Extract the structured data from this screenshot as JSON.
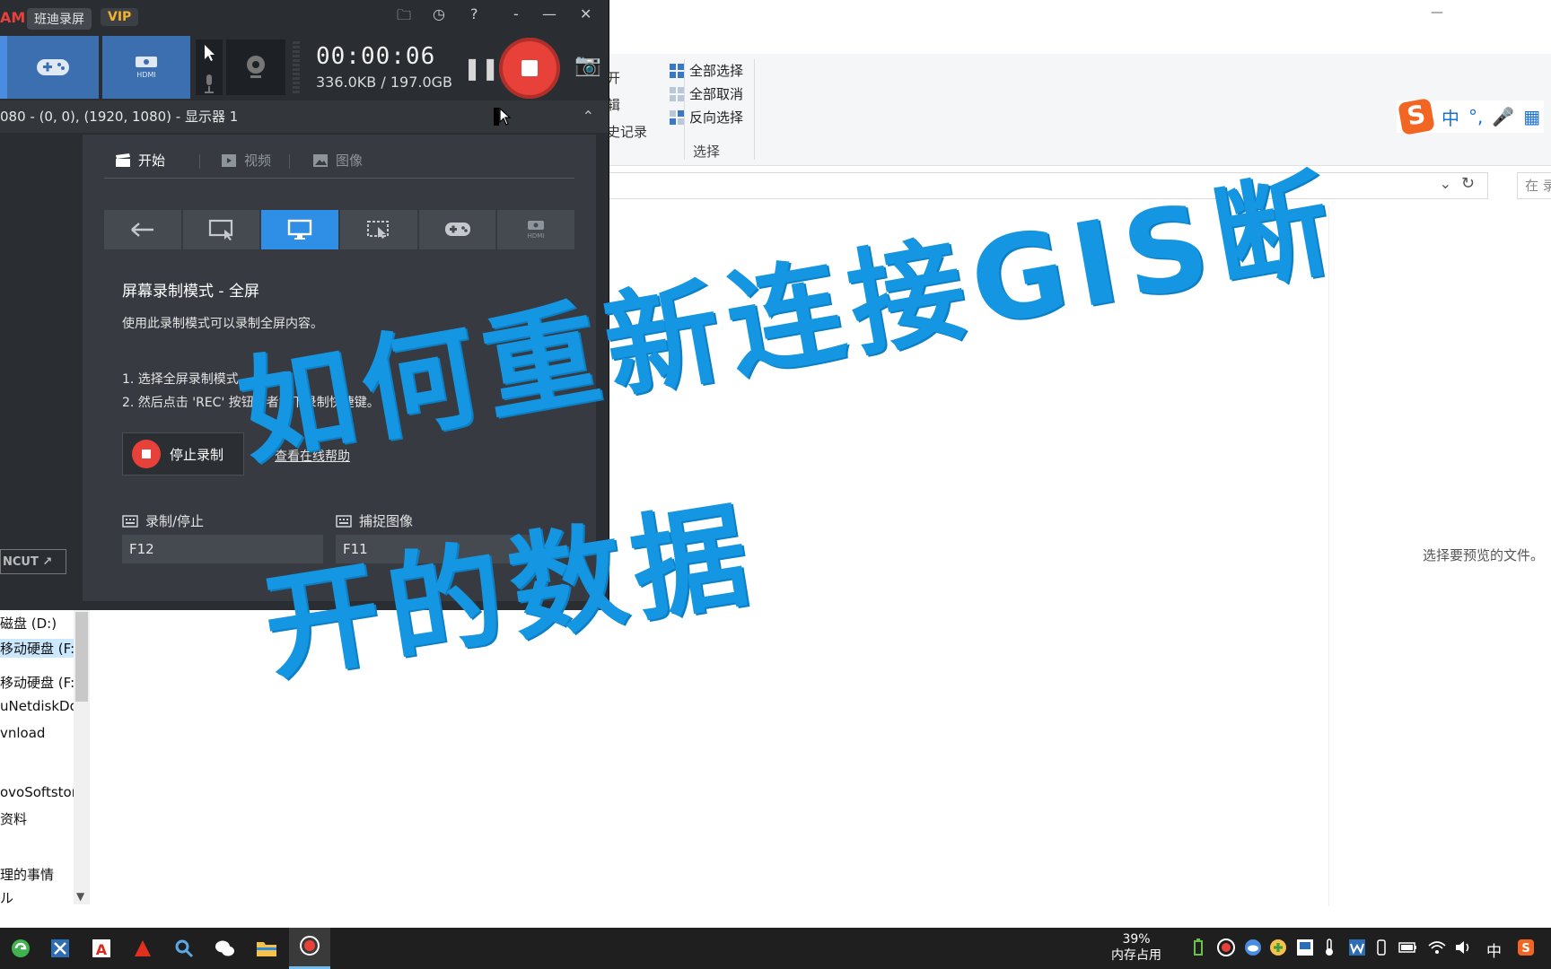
{
  "explorer": {
    "minimize_label": "—",
    "ribbon": {
      "partial_items": [
        "开",
        "辑",
        "史记录"
      ],
      "select_all": "全部选择",
      "select_none": "全部取消",
      "invert_select": "反向选择",
      "group_label": "选择"
    },
    "address": {
      "chevron": "⌄",
      "refresh": "↻",
      "search_placeholder": "在 录"
    },
    "preview_text": "选择要预览的文件。",
    "nav_items": [
      {
        "label": "磁盘 (D:)"
      },
      {
        "label": "移动硬盘 (F:"
      },
      {
        "label": "移动硬盘 (F:)"
      },
      {
        "label": "uNetdiskDo"
      },
      {
        "label": "vnload"
      },
      {
        "label": "ovoSoftstor"
      },
      {
        "label": "资料"
      },
      {
        "label": "理的事情"
      },
      {
        "label": "ル"
      }
    ]
  },
  "ime": {
    "logo": "S",
    "items": [
      "中",
      "°,",
      "🎤",
      "▦"
    ]
  },
  "bandicam": {
    "logo": "AM",
    "app_name": "班迪录屏",
    "vip": "VIP",
    "title_icons": [
      "🗀",
      "◷",
      "?",
      "-",
      "—",
      "✕"
    ],
    "timer": "00:00:06",
    "size": "336.0KB / 197.0GB",
    "pause": "❚❚",
    "camera": "📷",
    "target": "080 - (0, 0), (1920, 1080) - 显示器 1",
    "target_up": "⌃",
    "tabs": [
      "开始",
      "视频",
      "图像"
    ],
    "mode_title": "屏幕录制模式 - 全屏",
    "mode_desc": "使用此录制模式可以录制全屏内容。",
    "step1": "1. 选择全屏录制模式。",
    "step2": "2. 然后点击 'REC' 按钮或者摁下录制快捷键。",
    "stop_button": "停止录制",
    "help_link": "查看在线帮助",
    "hotkey_record_label": "录制/停止",
    "hotkey_record": "F12",
    "hotkey_capture_label": "捕捉图像",
    "hotkey_capture": "F11",
    "bandicut": "NCUT ↗"
  },
  "overlay": {
    "line1": "如何重新连接GIS断",
    "line2": "开的数据"
  },
  "taskbar": {
    "mem_percent": "39%",
    "mem_label": "内存占用",
    "ime_tray": "中"
  }
}
